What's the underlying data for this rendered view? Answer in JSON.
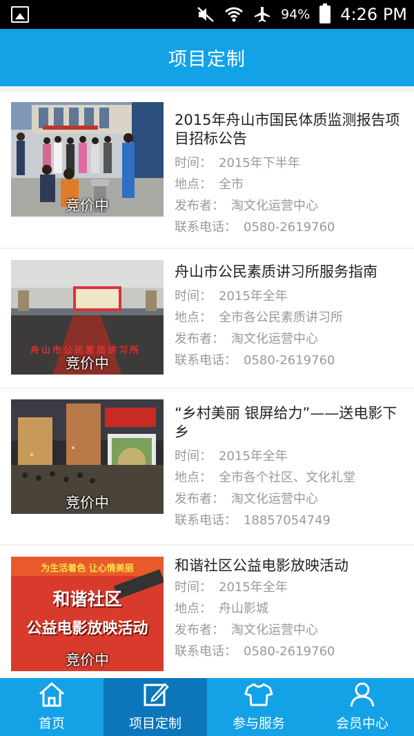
{
  "status_bar": {
    "battery": "94%",
    "time": "4:26 PM"
  },
  "header": {
    "title": "项目定制"
  },
  "labels": {
    "time": "时间：",
    "place": "地点：",
    "publisher": "发布者：",
    "phone": "联系电话："
  },
  "items": [
    {
      "title": "2015年舟山市国民体质监测报告项目招标公告",
      "badge": "竞价中",
      "time": "2015年下半年",
      "place": "全市",
      "publisher": "淘文化运营中心",
      "phone": "0580-2619760"
    },
    {
      "title": "舟山市公民素质讲习所服务指南",
      "badge": "竞价中",
      "time": "2015年全年",
      "place": "全市各公民素质讲习所",
      "publisher": "淘文化运营中心",
      "phone": "0580-2619760",
      "image_caption": "舟山市公民素质讲习所"
    },
    {
      "title": "“乡村美丽 银屏给力”——送电影下乡",
      "badge": "竞价中",
      "time": "2015年全年",
      "place": "全市各个社区、文化礼堂",
      "publisher": "淘文化运营中心",
      "phone": "18857054749"
    },
    {
      "title": "和谐社区公益电影放映活动",
      "badge": "竞价中",
      "time": "2015年全年",
      "place": "舟山影城",
      "publisher": "淘文化运营中心",
      "phone": "0580-2619760",
      "poster": {
        "slogan": "为生活着色  让心情美丽",
        "line1": "和谐社区",
        "line2": "公益电影放映活动"
      }
    }
  ],
  "nav": [
    {
      "label": "首页",
      "icon": "home-icon"
    },
    {
      "label": "项目定制",
      "icon": "edit-icon",
      "active": true
    },
    {
      "label": "参与服务",
      "icon": "shirt-icon"
    },
    {
      "label": "会员中心",
      "icon": "user-icon"
    }
  ]
}
